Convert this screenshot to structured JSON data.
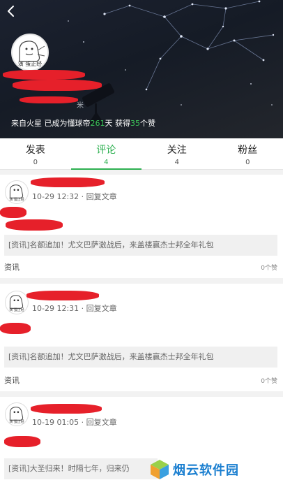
{
  "profile": {
    "back_icon": "chevron-left-icon",
    "avatar_caption": "演 蛋正经",
    "header_tail": "米",
    "stats": {
      "prefix": "来自火星 已成为懂球帝",
      "days": "261",
      "days_unit": "天 获得",
      "likes": "35",
      "likes_unit": "个赞"
    }
  },
  "tabs": [
    {
      "label": "发表",
      "count": "0",
      "active": false
    },
    {
      "label": "评论",
      "count": "4",
      "active": true
    },
    {
      "label": "关注",
      "count": "4",
      "active": false
    },
    {
      "label": "粉丝",
      "count": "0",
      "active": false
    }
  ],
  "comments": [
    {
      "avatar_caption": "演 蛋正经",
      "time": "10-29 12:32",
      "reply_label": "回复文章",
      "article": "[资讯]名额追加！尤文巴萨激战后，来盖楼赢杰士邦全年礼包",
      "source": "资讯",
      "likes": "0个赞"
    },
    {
      "avatar_caption": "演 蛋正经",
      "time": "10-29 12:31",
      "reply_label": "回复文章",
      "article": "[资讯]名额追加！尤文巴萨激战后，来盖楼赢杰士邦全年礼包",
      "source": "资讯",
      "likes": "0个赞"
    },
    {
      "avatar_caption": "演 蛋正经",
      "time": "10-19 01:05",
      "reply_label": "回复文章",
      "article": "[资讯]大圣归来！时隔七年，归来仍",
      "source": "",
      "likes": ""
    }
  ],
  "watermark": {
    "text": "烟云软件园",
    "icon": "cube-logo-icon"
  },
  "colors": {
    "accent_green": "#2db050",
    "redaction": "#e6202a",
    "header_bg": "#1c2230"
  }
}
